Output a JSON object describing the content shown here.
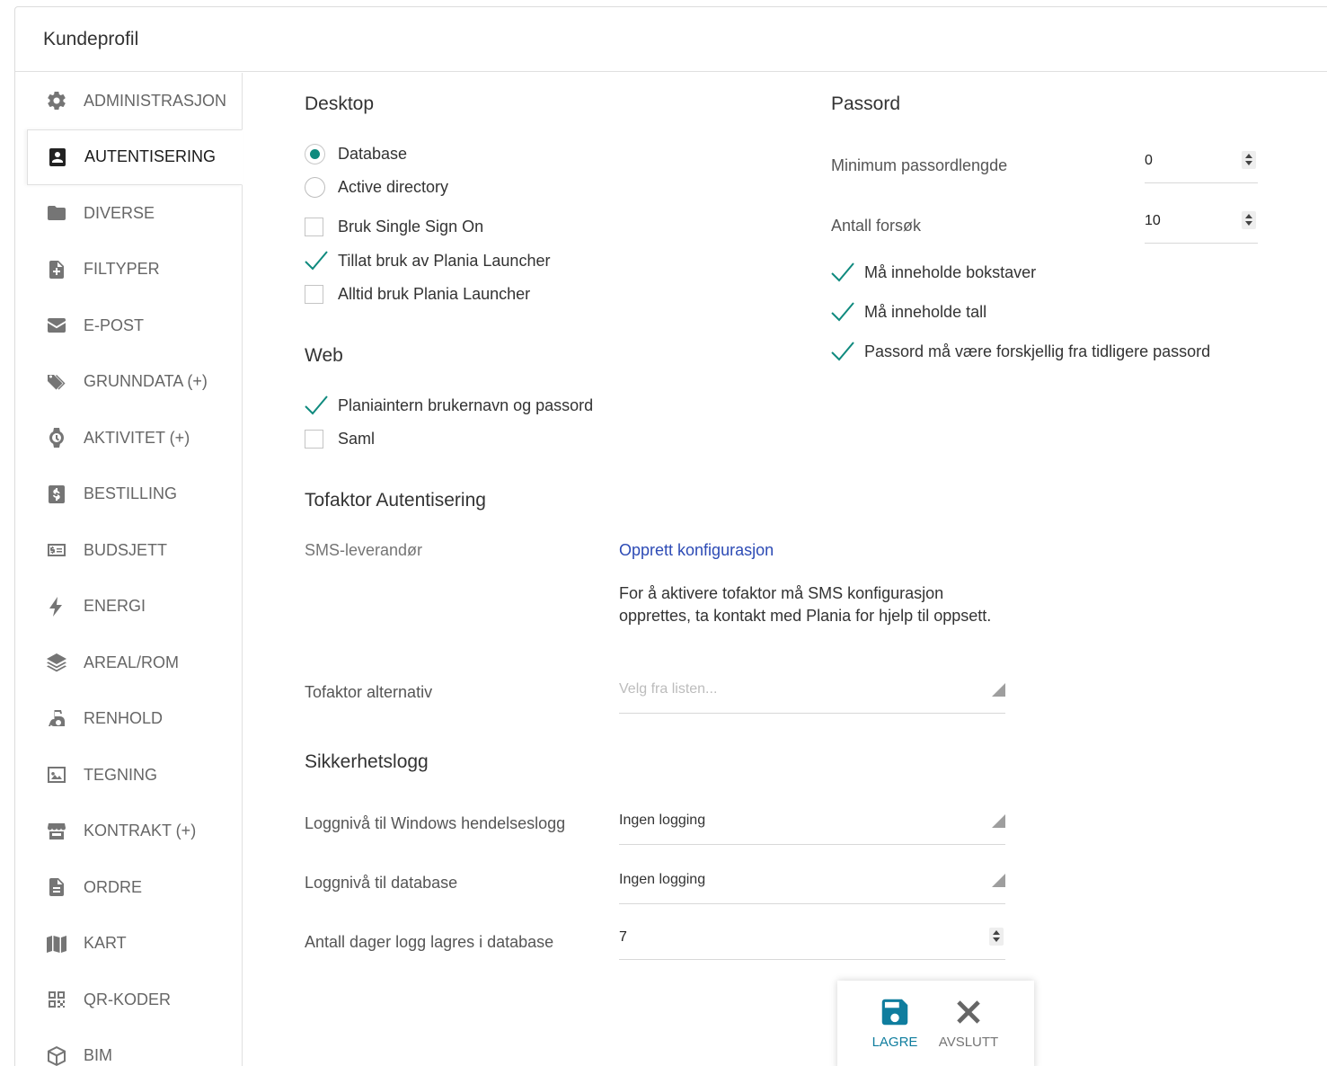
{
  "window": {
    "title": "Kundeprofil"
  },
  "sidebar": {
    "items": [
      {
        "label": "ADMINISTRASJON",
        "icon": "gear-icon"
      },
      {
        "label": "AUTENTISERING",
        "icon": "id-card-icon",
        "active": true
      },
      {
        "label": "DIVERSE",
        "icon": "folder-icon"
      },
      {
        "label": "FILTYPER",
        "icon": "file-plus-icon"
      },
      {
        "label": "E-POST",
        "icon": "envelope-icon"
      },
      {
        "label": "GRUNNDATA (+)",
        "icon": "tags-icon"
      },
      {
        "label": "AKTIVITET (+)",
        "icon": "watch-icon"
      },
      {
        "label": "BESTILLING",
        "icon": "dollar-file-icon"
      },
      {
        "label": "BUDSJETT",
        "icon": "money-list-icon"
      },
      {
        "label": "ENERGI",
        "icon": "bolt-icon"
      },
      {
        "label": "AREAL/ROM",
        "icon": "layers-icon"
      },
      {
        "label": "RENHOLD",
        "icon": "cleaning-icon"
      },
      {
        "label": "TEGNING",
        "icon": "image-icon"
      },
      {
        "label": "KONTRAKT (+)",
        "icon": "store-icon"
      },
      {
        "label": "ORDRE",
        "icon": "document-icon"
      },
      {
        "label": "KART",
        "icon": "map-icon"
      },
      {
        "label": "QR-KODER",
        "icon": "qr-code-icon"
      },
      {
        "label": "BIM",
        "icon": "cube-icon"
      }
    ]
  },
  "desktop": {
    "title": "Desktop",
    "radio_database": "Database",
    "radio_active_directory": "Active directory",
    "selected": "Database",
    "sso": {
      "label": "Bruk Single Sign On",
      "checked": false
    },
    "allow_launcher": {
      "label": "Tillat bruk av Plania Launcher",
      "checked": true
    },
    "always_launcher": {
      "label": "Alltid bruk Plania Launcher",
      "checked": false
    }
  },
  "web": {
    "title": "Web",
    "internal": {
      "label": "Planiaintern brukernavn og passord",
      "checked": true
    },
    "saml": {
      "label": "Saml",
      "checked": false
    }
  },
  "password": {
    "title": "Passord",
    "min_length_label": "Minimum passordlengde",
    "min_length_value": "0",
    "attempts_label": "Antall forsøk",
    "attempts_value": "10",
    "letters": {
      "label": "Må inneholde bokstaver",
      "checked": true
    },
    "numbers": {
      "label": "Må inneholde tall",
      "checked": true
    },
    "different": {
      "label": "Passord må være forskjellig fra tidligere passord",
      "checked": true
    }
  },
  "twofactor": {
    "title": "Tofaktor Autentisering",
    "sms_label": "SMS-leverandør",
    "sms_link": "Opprett konfigurasjon",
    "info": "For å aktivere tofaktor må SMS konfigurasjon opprettes, ta kontakt med Plania for hjelp til oppsett.",
    "alt_label": "Tofaktor alternativ",
    "alt_placeholder": "Velg fra listen..."
  },
  "securitylog": {
    "title": "Sikkerhetslogg",
    "windows_label": "Loggnivå til Windows hendelseslogg",
    "windows_value": "Ingen logging",
    "db_label": "Loggnivå til database",
    "db_value": "Ingen logging",
    "days_label": "Antall dager logg lagres i database",
    "days_value": "7"
  },
  "actions": {
    "save_label": "LAGRE",
    "exit_label": "AVSLUTT"
  },
  "colors": {
    "accent": "#0f8a7e",
    "link": "#2d4bb5",
    "save_icon": "#0f7d9e"
  }
}
